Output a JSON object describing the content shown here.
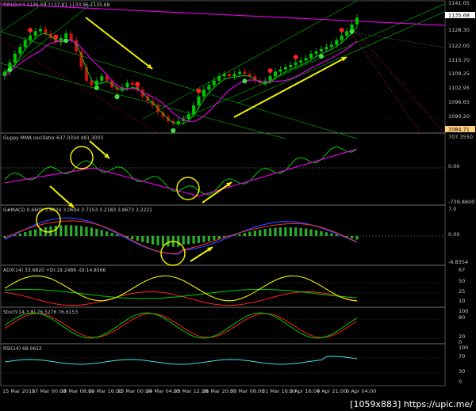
{
  "colors": {
    "background": "#000000",
    "candle_up": "#00c800",
    "candle_down": "#d01010",
    "ma_fast": "#00d000",
    "ma_slow": "#e000e0",
    "channel": "#00a000",
    "trendline": "#e000e0",
    "arrows": "#f0f000",
    "circles": "#f0f000",
    "macd_line": "#2040ff",
    "signal_line": "#ff3020",
    "adx_plus": "#f0f000",
    "adx_main": "#00d000",
    "adx_minus": "#ff2020",
    "stoch_main": "#00d000",
    "stoch_signal": "#ff2020",
    "rsi": "#40e0e0",
    "price_tag": "#ffd080"
  },
  "main": {
    "header": "GOLD,H4  1136.59 1137.81 1133.96 1135.68",
    "last_price_tag": "1135.68",
    "level_tag": "1084.71",
    "y_ticks": [
      "1141.05",
      "1128.30",
      "1122.00",
      "1115.70",
      "1109.25",
      "1102.95",
      "1096.65",
      "1090.20",
      "1084.71"
    ]
  },
  "guppy": {
    "header": "Guppy MMA oscillator 637.0334 491.3003",
    "y_ticks": [
      "707.3550",
      "0.00",
      "-739.8600"
    ]
  },
  "macd": {
    "header": "G#MACD 0.4609 3.6024 3.0694 3.7153 3.2183 3.8673 3.2221",
    "y_ticks": [
      "7.0",
      "0.00",
      "-6.8354"
    ]
  },
  "adx": {
    "header": "ADX(14) 33.6820 +DI:19.2486 -DI:14.8566",
    "y_ticks": [
      "67",
      "50",
      "25",
      "10"
    ]
  },
  "stoch": {
    "header": "Stoch(14,3,8) 76.5276 76.6153",
    "y_ticks": [
      "100",
      "80",
      "20",
      "0"
    ]
  },
  "rsi": {
    "header": "RSI(14) 68.0612",
    "y_ticks": [
      "100",
      "70",
      "30",
      "0"
    ]
  },
  "x_ticks": [
    "15 Mar 2010",
    "17 Mar 00:00",
    "18 Mar 08:00",
    "19 Mar 16:00",
    "23 Mar 00:00",
    "24 Mar 04:00",
    "25 Mar 12:00",
    "26 Mar 20:00",
    "30 Mar 08:00",
    "31 Mar 16:00",
    "1 Apr 16:00",
    "4 Apr 21:00",
    "6 Apr 04:00"
  ],
  "watermark": "[1059x883] https://upic.me/",
  "chart_data": {
    "type": "line",
    "price_series": {
      "name": "GOLD,H4",
      "close": [
        1112,
        1116,
        1120,
        1123,
        1126,
        1128,
        1130,
        1131,
        1129,
        1127,
        1125,
        1127,
        1129,
        1126,
        1121,
        1114,
        1108,
        1106,
        1108,
        1110,
        1108,
        1105,
        1104,
        1105,
        1107,
        1106,
        1104,
        1101,
        1099,
        1097,
        1094,
        1092,
        1090,
        1089,
        1090,
        1091,
        1093,
        1097,
        1101,
        1104,
        1106,
        1108,
        1110,
        1111,
        1110,
        1111,
        1112,
        1111,
        1110,
        1108,
        1107,
        1108,
        1110,
        1112,
        1113,
        1114,
        1115,
        1116,
        1117,
        1118,
        1120,
        1121,
        1122,
        1123,
        1124,
        1126,
        1128,
        1130,
        1133,
        1136
      ],
      "ylim": [
        1084.71,
        1141.05
      ]
    },
    "guppy_oscillator": {
      "values_last": [
        637.0334,
        491.3003
      ],
      "ylim": [
        -739.86,
        707.355
      ]
    },
    "macd": {
      "values_last": [
        0.4609,
        3.6024,
        3.0694,
        3.7153,
        3.2183,
        3.8673,
        3.2221
      ],
      "ylim": [
        -6.8354,
        7.0
      ]
    },
    "adx": {
      "adx": 33.682,
      "plus_di": 19.2486,
      "minus_di": 14.8566,
      "ylim": [
        0,
        67
      ]
    },
    "stochastic": {
      "main": 76.5276,
      "signal": 76.6153,
      "ylim": [
        0,
        100
      ]
    },
    "rsi": {
      "value": 68.0612,
      "ylim": [
        0,
        100
      ]
    }
  }
}
